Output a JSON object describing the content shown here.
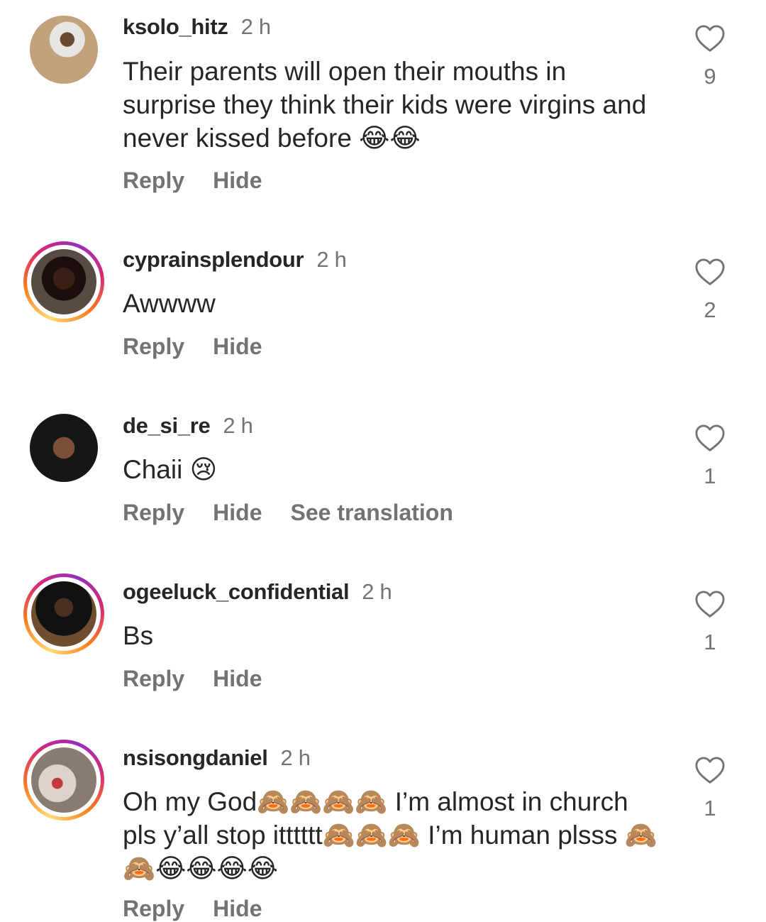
{
  "comments": [
    {
      "username": "ksolo_hitz",
      "time": "2 h",
      "text": "Their parents will open their mouths in surprise they think their kids were virgins and never kissed before 😂😂",
      "actions": [
        "Reply",
        "Hide"
      ],
      "likes": "9",
      "story_ring": false
    },
    {
      "username": "cyprainsplendour",
      "time": "2 h",
      "text": "Awwww",
      "actions": [
        "Reply",
        "Hide"
      ],
      "likes": "2",
      "story_ring": true
    },
    {
      "username": "de_si_re",
      "time": "2 h",
      "text": "Chaii 😢",
      "actions": [
        "Reply",
        "Hide",
        "See translation"
      ],
      "likes": "1",
      "story_ring": false
    },
    {
      "username": "ogeeluck_confidential",
      "time": "2 h",
      "text": "Bs",
      "actions": [
        "Reply",
        "Hide"
      ],
      "likes": "1",
      "story_ring": true
    },
    {
      "username": "nsisongdaniel",
      "time": "2 h",
      "text": "Oh my God🙈🙈🙈🙈 I’m almost in church pls y’all stop itttttt🙈🙈🙈 I’m human plsss 🙈🙈😂😂😂😂",
      "actions": [
        "Reply",
        "Hide"
      ],
      "likes": "1",
      "story_ring": true
    }
  ],
  "icons": {
    "like": "heart-outline-icon"
  },
  "colors": {
    "primary_text": "#262626",
    "secondary_text": "#737373"
  }
}
